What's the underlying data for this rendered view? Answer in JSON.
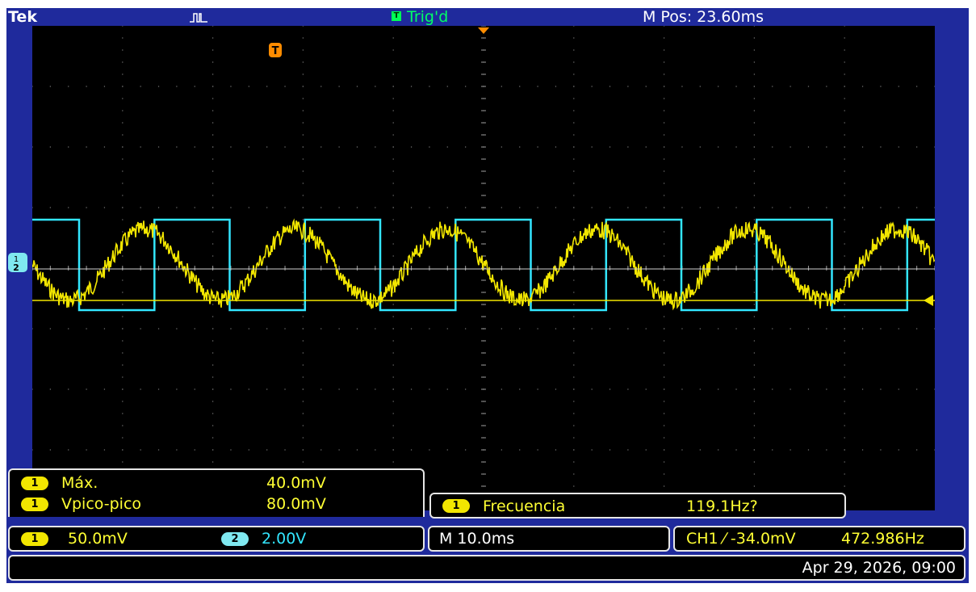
{
  "top_bar": {
    "brand": "Tek",
    "trigger_status": "Trig'd",
    "trigger_badge": "T",
    "m_pos": "M Pos: 23.60ms"
  },
  "screen": {
    "trigger_marker": "T",
    "ch1_marker": "1",
    "ch2_marker": "2"
  },
  "measurements": {
    "max_label": "Máx.",
    "max_value": "40.0mV",
    "vpp_label": "Vpico-pico",
    "vpp_value": "80.0mV",
    "freq_label": "Frecuencia",
    "freq_value": "119.1Hz?",
    "badge": "1"
  },
  "status": {
    "ch1_badge": "1",
    "ch1_scale": "50.0mV",
    "ch2_badge": "2",
    "ch2_scale": "2.00V",
    "timebase": "M 10.0ms",
    "trigger_info": "CH1 ⁄ -34.0mV",
    "trigger_freq": "472.986Hz",
    "datetime": "Apr 29, 2026, 09:00"
  },
  "colors": {
    "ch1": "#f2e600",
    "ch2": "#33e6ff",
    "frame": "#1f2a9c",
    "trigger": "#ff8c00",
    "trig_status": "#00ff66"
  },
  "icons": {
    "acquisition": "pulse-icon",
    "trigger": "trigger-icon"
  }
}
